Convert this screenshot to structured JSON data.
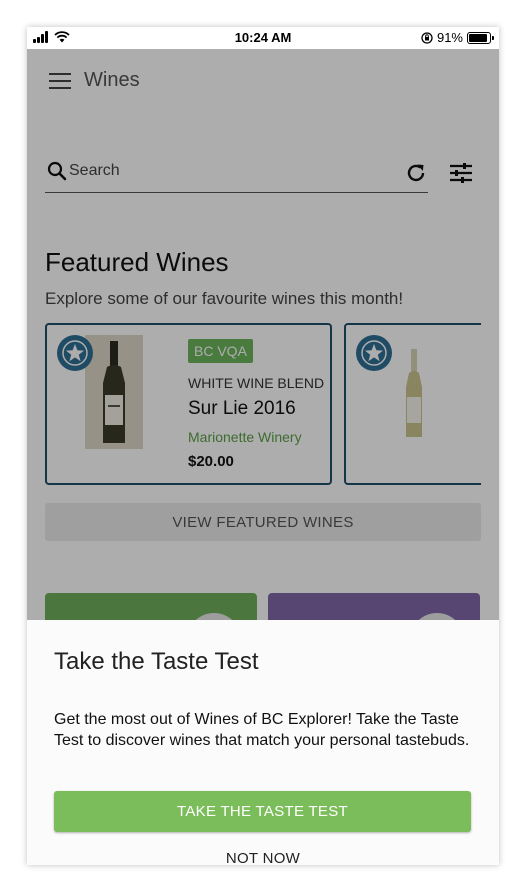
{
  "status_bar": {
    "time": "10:24 AM",
    "battery_text": "91%",
    "battery_level": 0.91
  },
  "app_bar": {
    "title": "Wines",
    "menu_icon": "hamburger-menu-icon"
  },
  "search": {
    "placeholder": "Search",
    "value": "",
    "icons": [
      "search-icon",
      "refresh-icon",
      "filter-sliders-icon"
    ]
  },
  "featured": {
    "title": "Featured Wines",
    "subtitle": "Explore some of our favourite wines this month!",
    "cards": [
      {
        "badge": "BC VQA",
        "type": "WHITE WINE BLEND",
        "name": "Sur Lie 2016",
        "winery": "Marionette Winery",
        "price": "$20.00"
      },
      {
        "badge": "",
        "type": "",
        "name": "",
        "winery": "",
        "price": ""
      }
    ],
    "view_button": "VIEW FEATURED WINES"
  },
  "colors": {
    "accent_green": "#7cbd5b",
    "card_border": "#1f4e6b",
    "winery_green": "#5aa048",
    "star_badge_blue": "#2f6f95",
    "tile_green": "#6fae5c",
    "tile_purple": "#8066a8"
  },
  "sheet": {
    "title": "Take the Taste Test",
    "body": "Get the most out of Wines of BC Explorer! Take the Taste Test to discover wines that match your personal tastebuds.",
    "primary_button": "TAKE THE TASTE TEST",
    "secondary_button": "NOT NOW"
  }
}
